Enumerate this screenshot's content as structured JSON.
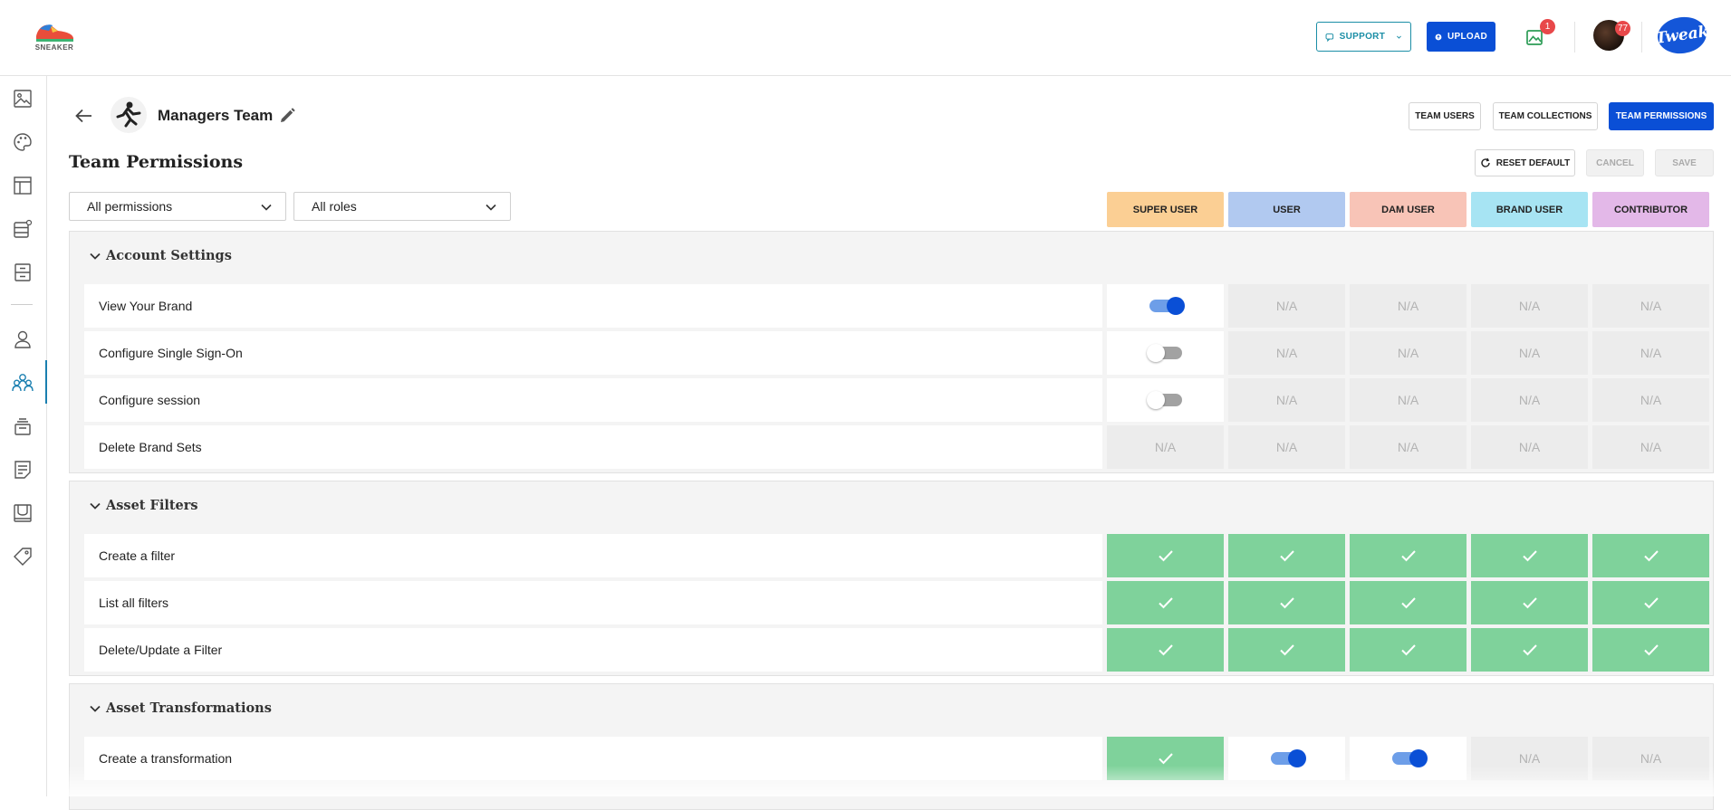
{
  "header": {
    "logo_text": "SNEAKER",
    "support_label": "SUPPORT",
    "upload_label": "UPLOAD",
    "gallery_badge": "1",
    "avatar_badge": "77",
    "brand_logo": "Tweak"
  },
  "sidebar": {
    "items": [
      {
        "icon": "image-icon"
      },
      {
        "icon": "palette-icon"
      },
      {
        "icon": "layout-icon"
      },
      {
        "icon": "database-settings-icon"
      },
      {
        "icon": "archive-icon"
      },
      {
        "icon": "user-icon"
      },
      {
        "icon": "team-icon",
        "active": true
      },
      {
        "icon": "stack-icon"
      },
      {
        "icon": "document-icon"
      },
      {
        "icon": "inbox-icon"
      },
      {
        "icon": "tag-icon"
      }
    ]
  },
  "team": {
    "name": "Managers Team"
  },
  "tabs": [
    {
      "label": "TEAM USERS",
      "active": false
    },
    {
      "label": "TEAM COLLECTIONS",
      "active": false
    },
    {
      "label": "TEAM PERMISSIONS",
      "active": true
    }
  ],
  "page": {
    "title": "Team Permissions",
    "reset_label": "RESET DEFAULT",
    "cancel_label": "CANCEL",
    "save_label": "SAVE"
  },
  "filters": {
    "permissions": "All permissions",
    "roles": "All roles"
  },
  "roles": [
    {
      "label": "SUPER USER",
      "color": "#fbcf94"
    },
    {
      "label": "USER",
      "color": "#b1c9f0"
    },
    {
      "label": "DAM USER",
      "color": "#f8c4b7"
    },
    {
      "label": "BRAND USER",
      "color": "#a7e4f3"
    },
    {
      "label": "CONTRIBUTOR",
      "color": "#e3b8e8"
    }
  ],
  "sections": [
    {
      "title": "Account Settings",
      "rows": [
        {
          "label": "View Your Brand",
          "cells": [
            "on",
            "N/A",
            "N/A",
            "N/A",
            "N/A"
          ]
        },
        {
          "label": "Configure Single Sign-On",
          "cells": [
            "off",
            "N/A",
            "N/A",
            "N/A",
            "N/A"
          ]
        },
        {
          "label": "Configure session",
          "cells": [
            "off",
            "N/A",
            "N/A",
            "N/A",
            "N/A"
          ]
        },
        {
          "label": "Delete Brand Sets",
          "cells": [
            "N/A",
            "N/A",
            "N/A",
            "N/A",
            "N/A"
          ]
        }
      ]
    },
    {
      "title": "Asset Filters",
      "rows": [
        {
          "label": "Create a filter",
          "cells": [
            "check",
            "check",
            "check",
            "check",
            "check"
          ]
        },
        {
          "label": "List all filters",
          "cells": [
            "check",
            "check",
            "check",
            "check",
            "check"
          ]
        },
        {
          "label": "Delete/Update a Filter",
          "cells": [
            "check",
            "check",
            "check",
            "check",
            "check"
          ]
        }
      ]
    },
    {
      "title": "Asset Transformations",
      "rows": [
        {
          "label": "Create a transformation",
          "cells": [
            "check",
            "on",
            "on",
            "N/A",
            "N/A"
          ]
        }
      ]
    }
  ],
  "colors": {
    "primary": "#0a4fd6",
    "support": "#1b8ea6",
    "check_cell": "#7fd29b",
    "na_cell": "#ececec",
    "badge": "#e8484a"
  }
}
